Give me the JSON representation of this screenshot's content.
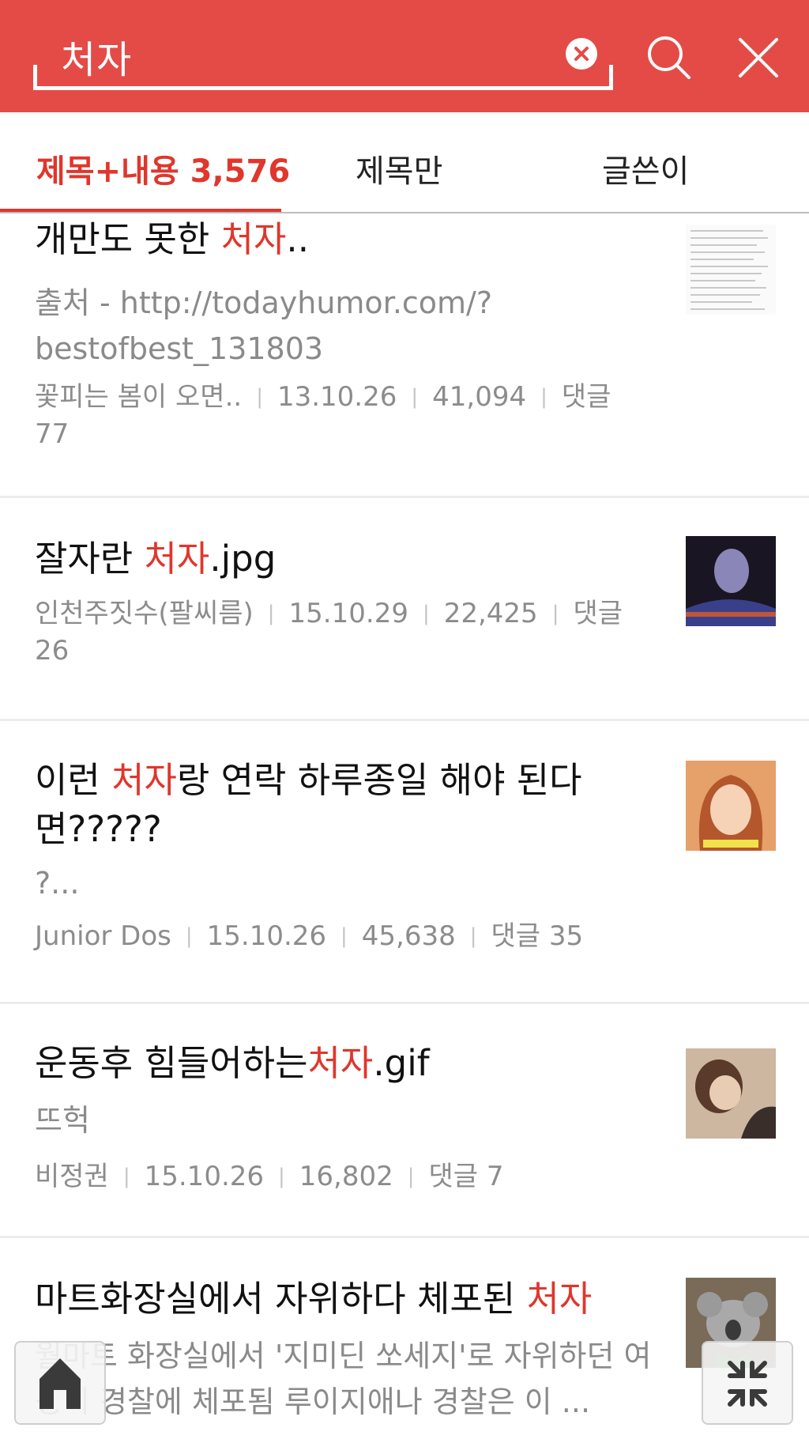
{
  "search": {
    "query": "처자"
  },
  "tabs": [
    {
      "label": "제목+내용 3,576"
    },
    {
      "label": "제목만"
    },
    {
      "label": "글쓴이"
    }
  ],
  "results": [
    {
      "title_before": "개만도 못한 ",
      "title_hl": "처자",
      "title_after": "..",
      "snippet": "출처 - http://todayhumor.com/?bestofbest_131803",
      "author": "꽃피는 봄이 오면..",
      "date": "13.10.26",
      "views": "41,094",
      "comments": "댓글 77"
    },
    {
      "title_before": "잘자란 ",
      "title_hl": "처자",
      "title_after": ".jpg",
      "snippet": "",
      "author": "인천주짓수(팔씨름)",
      "date": "15.10.29",
      "views": "22,425",
      "comments": "댓글 26"
    },
    {
      "title_before": "이런 ",
      "title_hl": "처자",
      "title_after": "랑 연락 하루종일 해야 된다면?????",
      "snippet": "?...",
      "author": "Junior Dos",
      "date": "15.10.26",
      "views": "45,638",
      "comments": "댓글 35"
    },
    {
      "title_before": "운동후 힘들어하는",
      "title_hl": "처자",
      "title_after": ".gif",
      "snippet": "뜨헉",
      "author": "비정권",
      "date": "15.10.26",
      "views": "16,802",
      "comments": "댓글 7"
    },
    {
      "title_before": "마트화장실에서 자위하다 체포된 ",
      "title_hl": "처자",
      "title_after": "",
      "snippet": "월마트 화장실에서 '지미딘 쏘세지'로 자위하던 여성이 경찰에 체포됨 루이지애나 경찰은 이 ...",
      "author": "",
      "date": "",
      "views": "",
      "comments": ""
    }
  ],
  "colors": {
    "header": "#e44b46",
    "accent": "#e0362c"
  },
  "icons": [
    "clear-icon",
    "search-icon",
    "close-icon",
    "home-icon",
    "collapse-icon"
  ]
}
